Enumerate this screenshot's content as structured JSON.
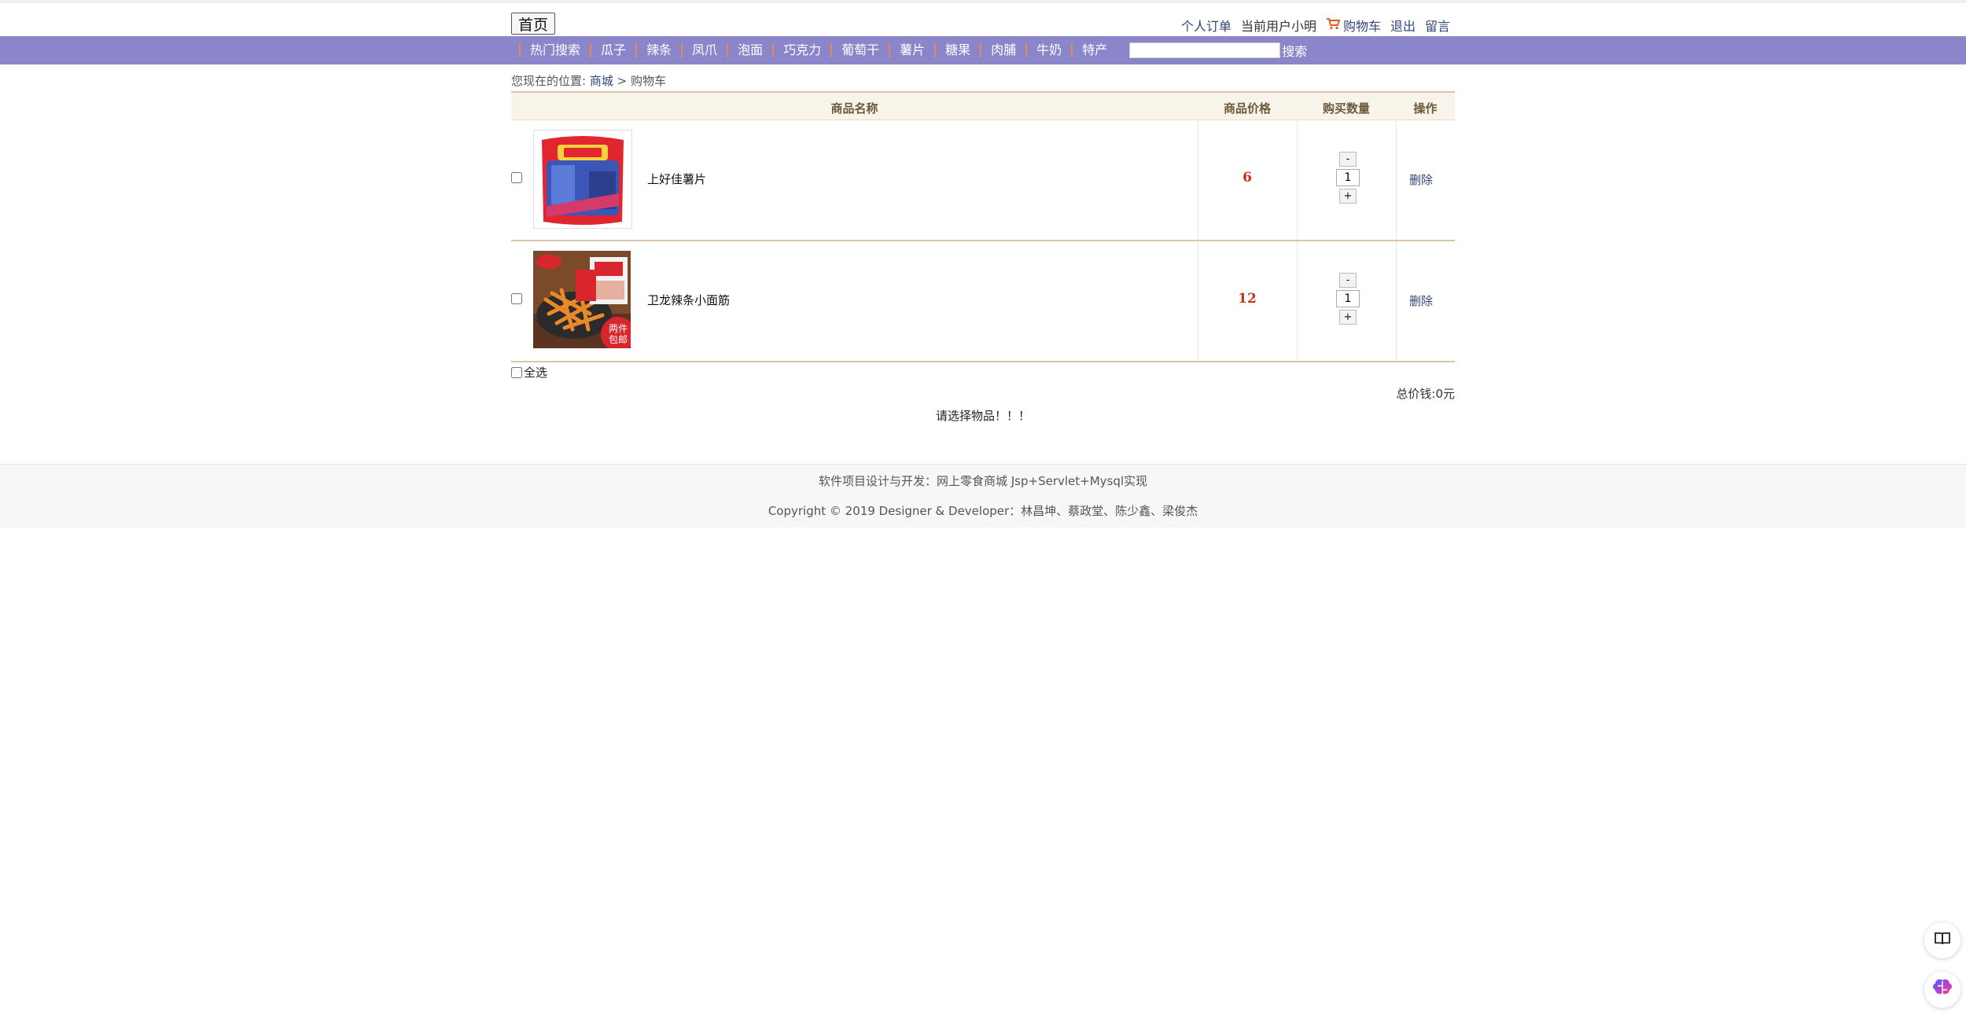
{
  "topbar": {
    "home_label": "首页",
    "orders_link": "个人订单",
    "current_user": "当前用户小明",
    "cart_link": "购物车",
    "logout_link": "退出",
    "message_link": "留言"
  },
  "nav": {
    "items": [
      "热门搜索",
      "瓜子",
      "辣条",
      "凤爪",
      "泡面",
      "巧克力",
      "葡萄干",
      "薯片",
      "糖果",
      "肉脯",
      "牛奶",
      "特产"
    ],
    "search_placeholder": "",
    "search_label": "搜索"
  },
  "breadcrumb": {
    "prefix": "您现在的位置:",
    "store": "商城",
    "sep": ">",
    "current": "购物车"
  },
  "table": {
    "headers": {
      "name": "商品名称",
      "price": "商品价格",
      "qty": "购买数量",
      "action": "操作"
    },
    "rows": [
      {
        "name": "上好佳薯片",
        "price": "6",
        "qty": "1",
        "delete": "删除",
        "image": "chips-bag"
      },
      {
        "name": "卫龙辣条小面筋",
        "price": "12",
        "qty": "1",
        "delete": "删除",
        "image": "spicy-strips",
        "badge": "两件包邮"
      }
    ],
    "minus": "-",
    "plus": "+"
  },
  "select_all": "全选",
  "total": "总价钱:0元",
  "message": "请选择物品！！！",
  "footer": {
    "line1": "软件项目设计与开发：网上零食商城 Jsp+Servlet+Mysql实现",
    "line2": "Copyright © 2019     Designer & Developer：林昌坤、蔡政堂、陈少鑫、梁俊杰"
  },
  "colors": {
    "nav_bg": "#8a86c9",
    "price": "#c0331f",
    "link": "#30467a"
  }
}
